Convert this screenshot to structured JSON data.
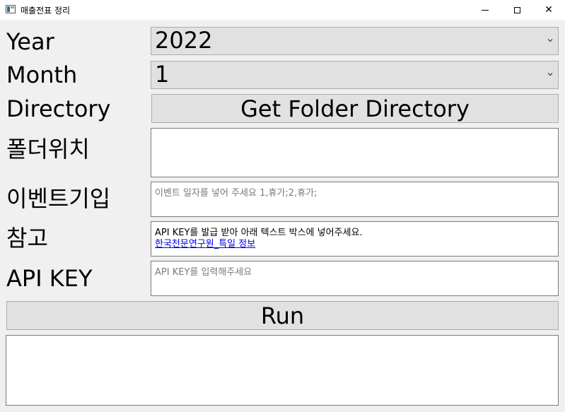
{
  "window": {
    "title": "매출전표 정리",
    "minimize_glyph": "—",
    "maximize_glyph": "☐",
    "close_glyph": "✕"
  },
  "form": {
    "year": {
      "label": "Year",
      "value": "2022"
    },
    "month": {
      "label": "Month",
      "value": "1"
    },
    "directory": {
      "label": "Directory",
      "button_label": "Get Folder Directory"
    },
    "folder_location": {
      "label": "폴더위치",
      "value": ""
    },
    "event_input": {
      "label": "이벤트기입",
      "placeholder": "이벤트 일자를 넣어 주세요 1,휴가;2,휴가;"
    },
    "reference": {
      "label": "참고",
      "text": "API KEY를 발급 받아 아래 텍스트 박스에 넣어주세요.",
      "link_text": "한국천문연구원_특일 정보"
    },
    "api_key": {
      "label": "API KEY",
      "placeholder": "API KEY를 입력해주세요"
    },
    "run_button_label": "Run",
    "output": ""
  },
  "icons": {
    "app": "app-icon",
    "dropdown": "chevron-down-icon"
  }
}
